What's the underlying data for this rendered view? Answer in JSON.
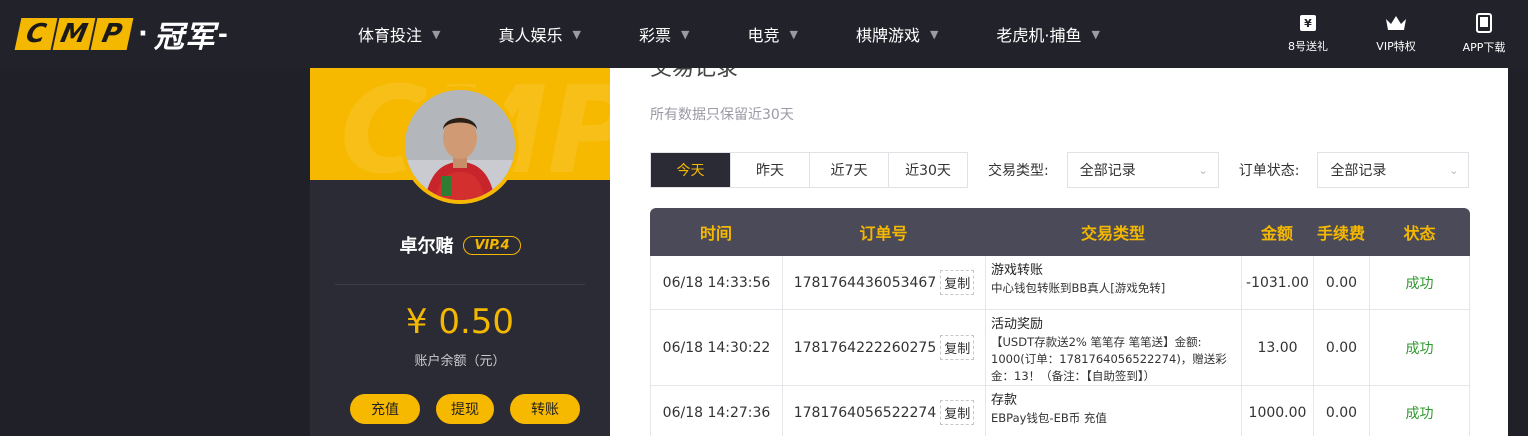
{
  "logo": {
    "letters": [
      "C",
      "M",
      "P"
    ],
    "dot": "·",
    "cn": "冠军",
    "dash": "-"
  },
  "nav": [
    {
      "label": "体育投注"
    },
    {
      "label": "真人娱乐"
    },
    {
      "label": "彩票"
    },
    {
      "label": "电竞"
    },
    {
      "label": "棋牌游戏"
    },
    {
      "label": "老虎机·捕鱼"
    }
  ],
  "right_icons": [
    {
      "label": "8号送礼",
      "icon": "gift-card-icon"
    },
    {
      "label": "VIP特权",
      "icon": "crown-icon"
    },
    {
      "label": "APP下载",
      "icon": "phone-icon"
    }
  ],
  "profile": {
    "bg_text": "CMP",
    "username": "卓尔赌",
    "vip": "VIP.4",
    "balance": "¥ 0.50",
    "balance_label": "账户余额（元）",
    "actions": [
      "充值",
      "提现",
      "转账"
    ]
  },
  "main": {
    "title": "交易记录",
    "notice": "所有数据只保留近30天",
    "periods": [
      "今天",
      "昨天",
      "近7天",
      "近30天"
    ],
    "active_period": "今天",
    "type_label": "交易类型:",
    "type_value": "全部记录",
    "status_label": "订单状态:",
    "status_value": "全部记录"
  },
  "table": {
    "headers": [
      "时间",
      "订单号",
      "交易类型",
      "金额",
      "手续费",
      "状态"
    ],
    "copy_label": "复制",
    "rows": [
      {
        "time": "06/18 14:33:56",
        "order": "1781764436053467",
        "type_title": "游戏转账",
        "type_desc": "中心钱包转账到BB真人[游戏免转]",
        "amount": "-1031.00",
        "fee": "0.00",
        "status": "成功"
      },
      {
        "time": "06/18 14:30:22",
        "order": "1781764222260275",
        "type_title": "活动奖励",
        "type_desc": "【USDT存款送2% 笔笔存 笔笔送】金额: 1000(订单：1781764056522274)，赠送彩金：13！（备注：【自助签到】）",
        "amount": "13.00",
        "fee": "0.00",
        "status": "成功"
      },
      {
        "time": "06/18 14:27:36",
        "order": "1781764056522274",
        "type_title": "存款",
        "type_desc": "EBPay钱包-EB币 充值",
        "amount": "1000.00",
        "fee": "0.00",
        "status": "成功"
      }
    ]
  },
  "colors": {
    "accent": "#f5b800",
    "dark": "#22222b",
    "success": "#2f9a2f"
  }
}
